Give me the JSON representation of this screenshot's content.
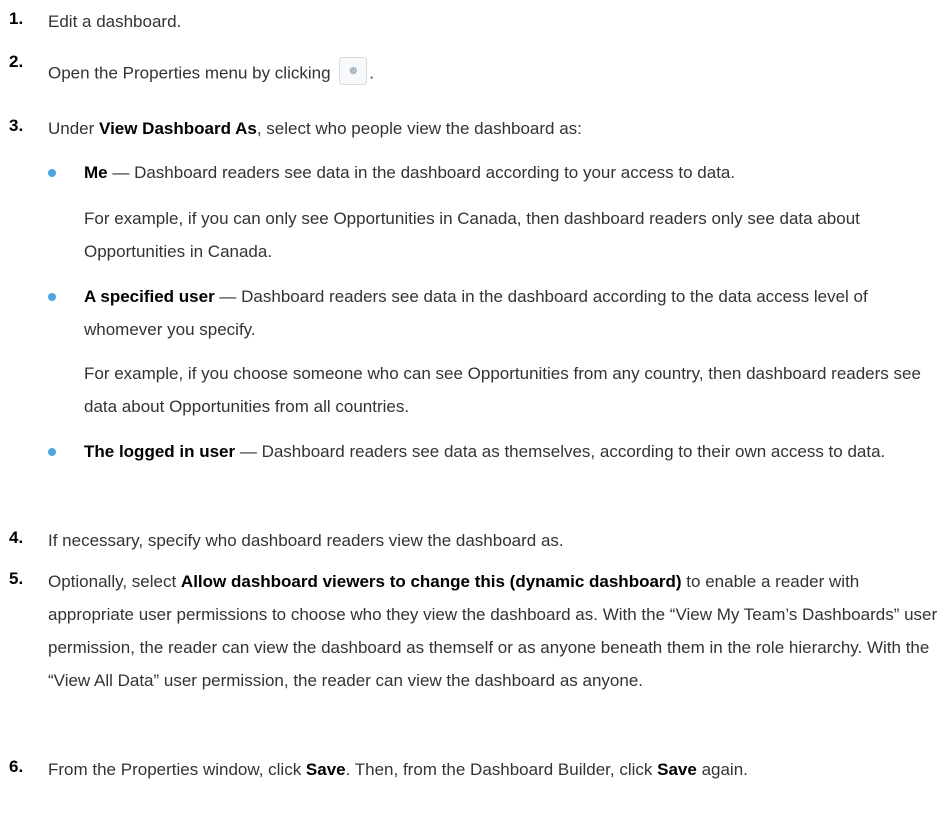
{
  "steps": [
    {
      "num": "1.",
      "text": "Edit a dashboard."
    },
    {
      "num": "2.",
      "text_before": "Open the Properties menu by clicking",
      "icon": "gear-icon",
      "text_after": "."
    },
    {
      "num": "3.",
      "pre": "Under ",
      "bold": "View Dashboard As",
      "post": ", select who people view the dashboard as:"
    },
    {
      "num": "4.",
      "text": "If necessary, specify who dashboard readers view the dashboard as."
    },
    {
      "num": "5.",
      "pre": "Optionally, select ",
      "bold": "Allow dashboard viewers to change this (dynamic dashboard)",
      "post": " to enable a reader with appropriate user permissions to choose who they view the dashboard as. With the “View My Team’s Dashboards” user permission, the reader can view the dashboard as themself or as anyone beneath them in the role hierarchy. With the “View All Data” user permission, the reader can view the dashboard as anyone."
    },
    {
      "num": "6.",
      "pre": "From the Properties window, click ",
      "bold": "Save",
      "mid": ". Then, from the Dashboard Builder, click ",
      "bold2": "Save",
      "post": " again."
    }
  ],
  "options": [
    {
      "bold": "Me",
      "desc": " — Dashboard readers see data in the dashboard according to your access to data.",
      "example": "For example, if you can only see Opportunities in Canada, then dashboard readers only see data about Opportunities in Canada."
    },
    {
      "bold": "A specified user",
      "desc": " — Dashboard readers see data in the dashboard according to the data access level of whomever you specify.",
      "example": "For example, if you choose someone who can see Opportunities from any country, then dashboard readers see data about Opportunities from all countries."
    },
    {
      "bold": "The logged in user",
      "desc": " — Dashboard readers see data as themselves, according to their own access to data.",
      "example": ""
    }
  ],
  "colors": {
    "bullet": "#4ea6e0"
  }
}
